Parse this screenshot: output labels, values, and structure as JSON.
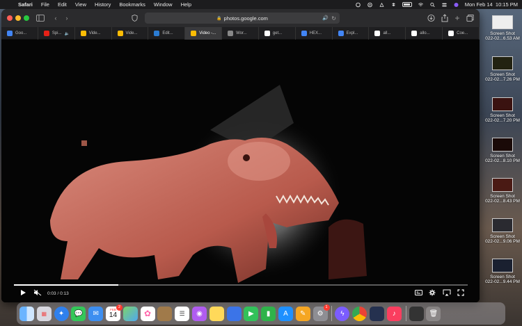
{
  "menubar": {
    "app_name": "Safari",
    "menus": [
      "File",
      "Edit",
      "View",
      "History",
      "Bookmarks",
      "Window",
      "Help"
    ],
    "clock": "Mon Feb 14  10:15 PM"
  },
  "browser": {
    "url": "photos.google.com",
    "tabs": [
      {
        "label": "Goo...",
        "color": "#4285f4"
      },
      {
        "label": "Spi...",
        "color": "#e62117"
      },
      {
        "label": "Vide...",
        "color": "#fbbc05"
      },
      {
        "label": "Vide...",
        "color": "#fbbc05"
      },
      {
        "label": "Edit...",
        "color": "#2b7cd3"
      },
      {
        "label": "Video -...",
        "color": "#fbbc05"
      },
      {
        "label": "Wor...",
        "color": "#888888"
      },
      {
        "label": "get...",
        "color": "#ffffff"
      },
      {
        "label": "HEX...",
        "color": "#4285f4"
      },
      {
        "label": "Expl...",
        "color": "#4285f4"
      },
      {
        "label": "all...",
        "color": "#ffffff"
      },
      {
        "label": "allo...",
        "color": "#ffffff"
      },
      {
        "label": "Coe...",
        "color": "#ffffff"
      }
    ],
    "active_tab_index": 5
  },
  "player": {
    "time": "0:03 / 0:13",
    "progress_fraction": 0.23
  },
  "screenshots": [
    {
      "line1": "Screen Shot",
      "line2": "022-02...6.53 AM"
    },
    {
      "line1": "Screen Shot",
      "line2": "022-02...7.26 PM"
    },
    {
      "line1": "Screen Shot",
      "line2": "022-02...7.20 PM"
    },
    {
      "line1": "Screen Shot",
      "line2": "022-02...8.10 PM"
    },
    {
      "line1": "Screen Shot",
      "line2": "022-02...8.43 PM"
    },
    {
      "line1": "Screen Shot",
      "line2": "022-02...9.06 PM"
    },
    {
      "line1": "Screen Shot",
      "line2": "022-02...9.44 PM"
    }
  ],
  "dock": {
    "calendar_month": "FEB",
    "calendar_day": "14",
    "calendar_badge": "2",
    "settings_badge": "1",
    "apps": [
      "finder-icon",
      "launchpad-icon",
      "safari-icon",
      "messages-icon",
      "mail-icon",
      "calendar-icon",
      "maps-icon",
      "photos-icon",
      "contacts-icon",
      "reminders-icon",
      "podcasts-icon",
      "notes-icon",
      "keynote-icon",
      "facetime-icon",
      "numbers-icon",
      "appstore-icon",
      "pages-icon",
      "system-preferences-icon",
      "messenger-icon",
      "chrome-icon",
      "davinci-icon",
      "music-icon"
    ]
  }
}
